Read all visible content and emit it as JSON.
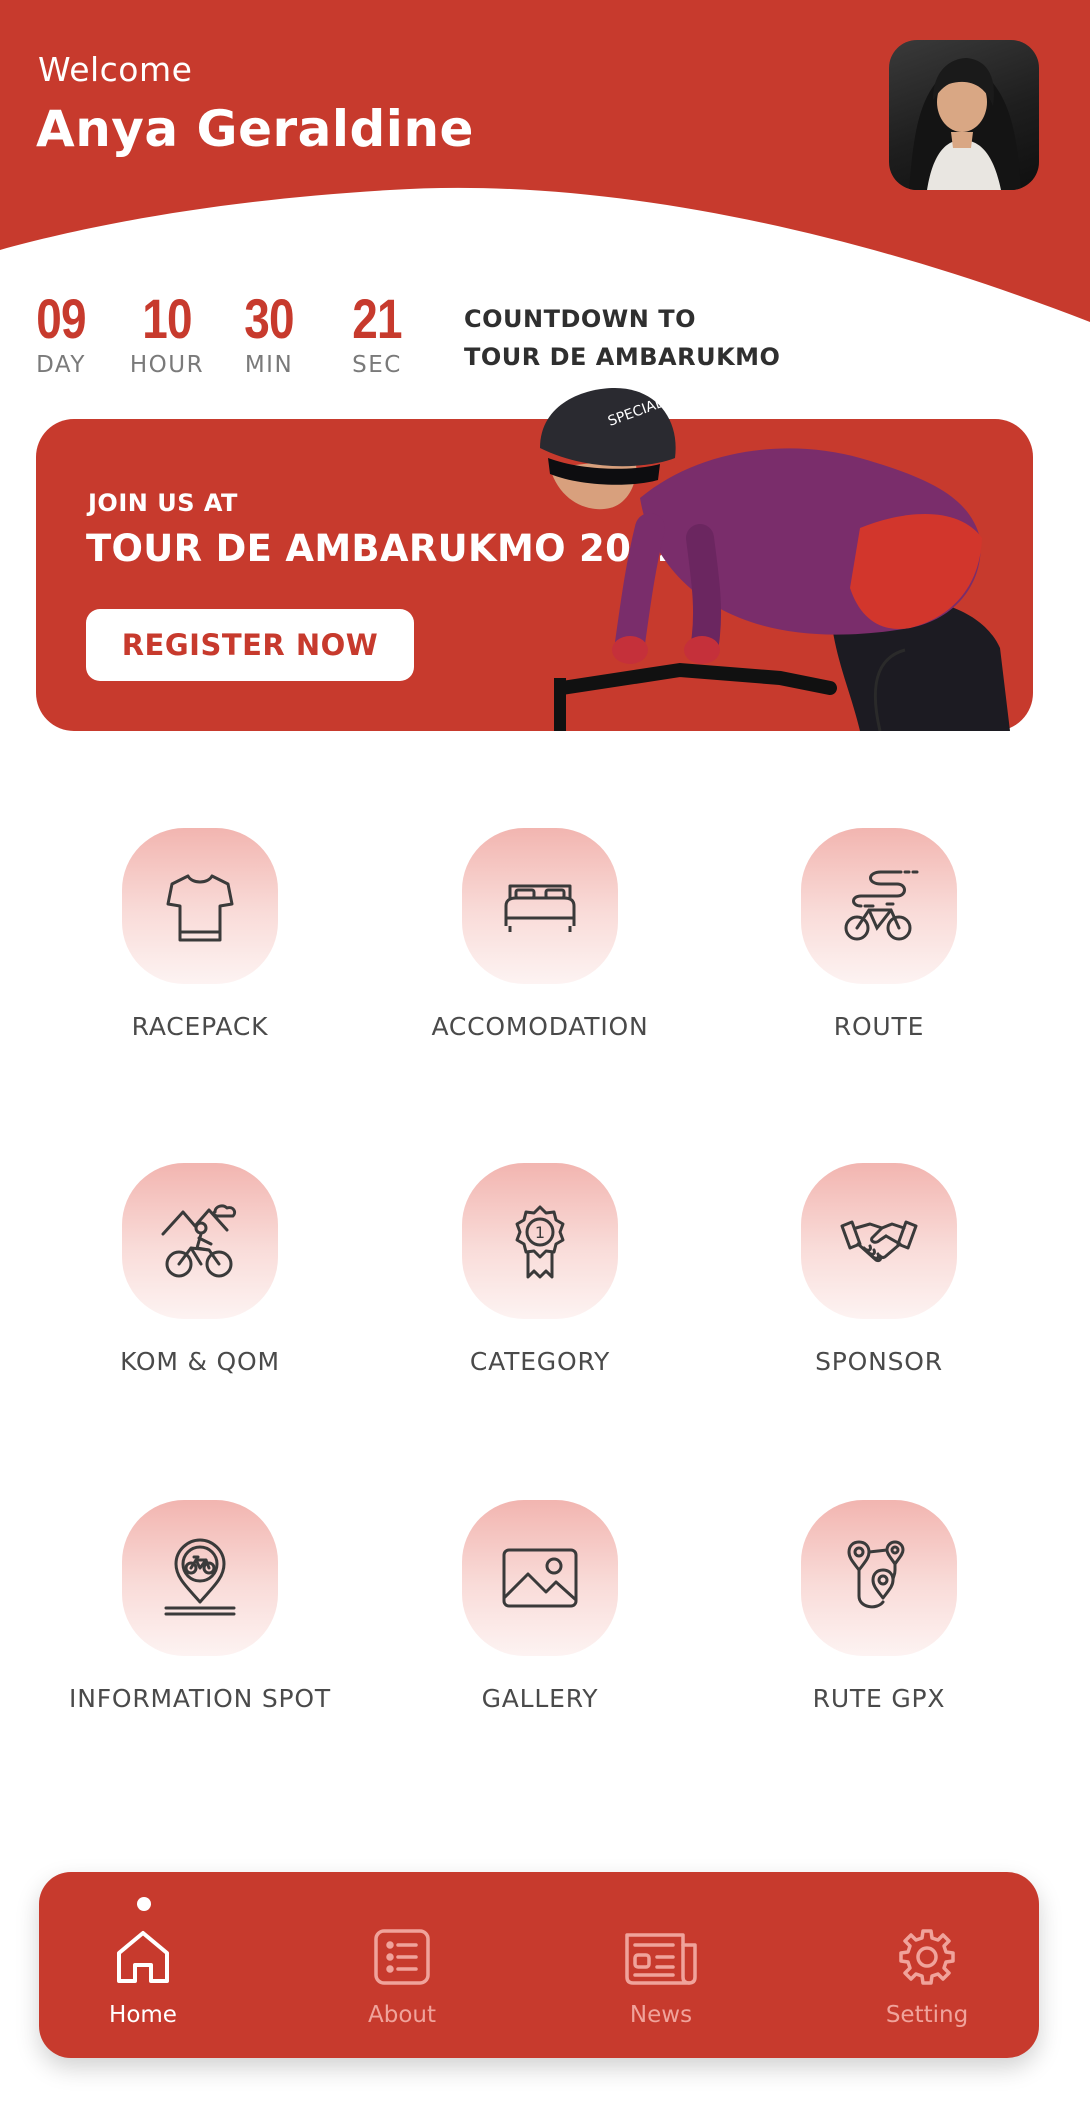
{
  "header": {
    "welcome": "Welcome",
    "user_name": "Anya Geraldine"
  },
  "countdown": {
    "units": [
      {
        "value": "09",
        "label": "DAY"
      },
      {
        "value": "10",
        "label": "HOUR"
      },
      {
        "value": "30",
        "label": "MIN"
      },
      {
        "value": "21",
        "label": "SEC"
      }
    ],
    "caption_line1": "COUNTDOWN TO",
    "caption_line2": "TOUR DE AMBARUKMO"
  },
  "banner": {
    "kicker": "JOIN US AT",
    "title": "TOUR DE AMBARUKMO 2022",
    "button": "REGISTER NOW"
  },
  "menu": [
    {
      "label": "RACEPACK",
      "icon": "jersey-icon"
    },
    {
      "label": "ACCOMODATION",
      "icon": "bed-icon"
    },
    {
      "label": "ROUTE",
      "icon": "bike-route-icon"
    },
    {
      "label": "KOM & QOM",
      "icon": "mountain-cyclist-icon"
    },
    {
      "label": "CATEGORY",
      "icon": "medal-icon"
    },
    {
      "label": "SPONSOR",
      "icon": "handshake-icon"
    },
    {
      "label": "INFORMATION SPOT",
      "icon": "bike-location-pin-icon"
    },
    {
      "label": "GALLERY",
      "icon": "image-icon"
    },
    {
      "label": "RUTE GPX",
      "icon": "map-pins-path-icon"
    }
  ],
  "nav": {
    "items": [
      {
        "label": "Home",
        "icon": "home-icon",
        "active": true
      },
      {
        "label": "About",
        "icon": "list-icon",
        "active": false
      },
      {
        "label": "News",
        "icon": "newspaper-icon",
        "active": false
      },
      {
        "label": "Setting",
        "icon": "gear-icon",
        "active": false
      }
    ]
  },
  "colors": {
    "brand_red": "#c73a2d",
    "icon_bg_top": "#f2b5b0",
    "nav_inactive": "#f0a39b"
  }
}
